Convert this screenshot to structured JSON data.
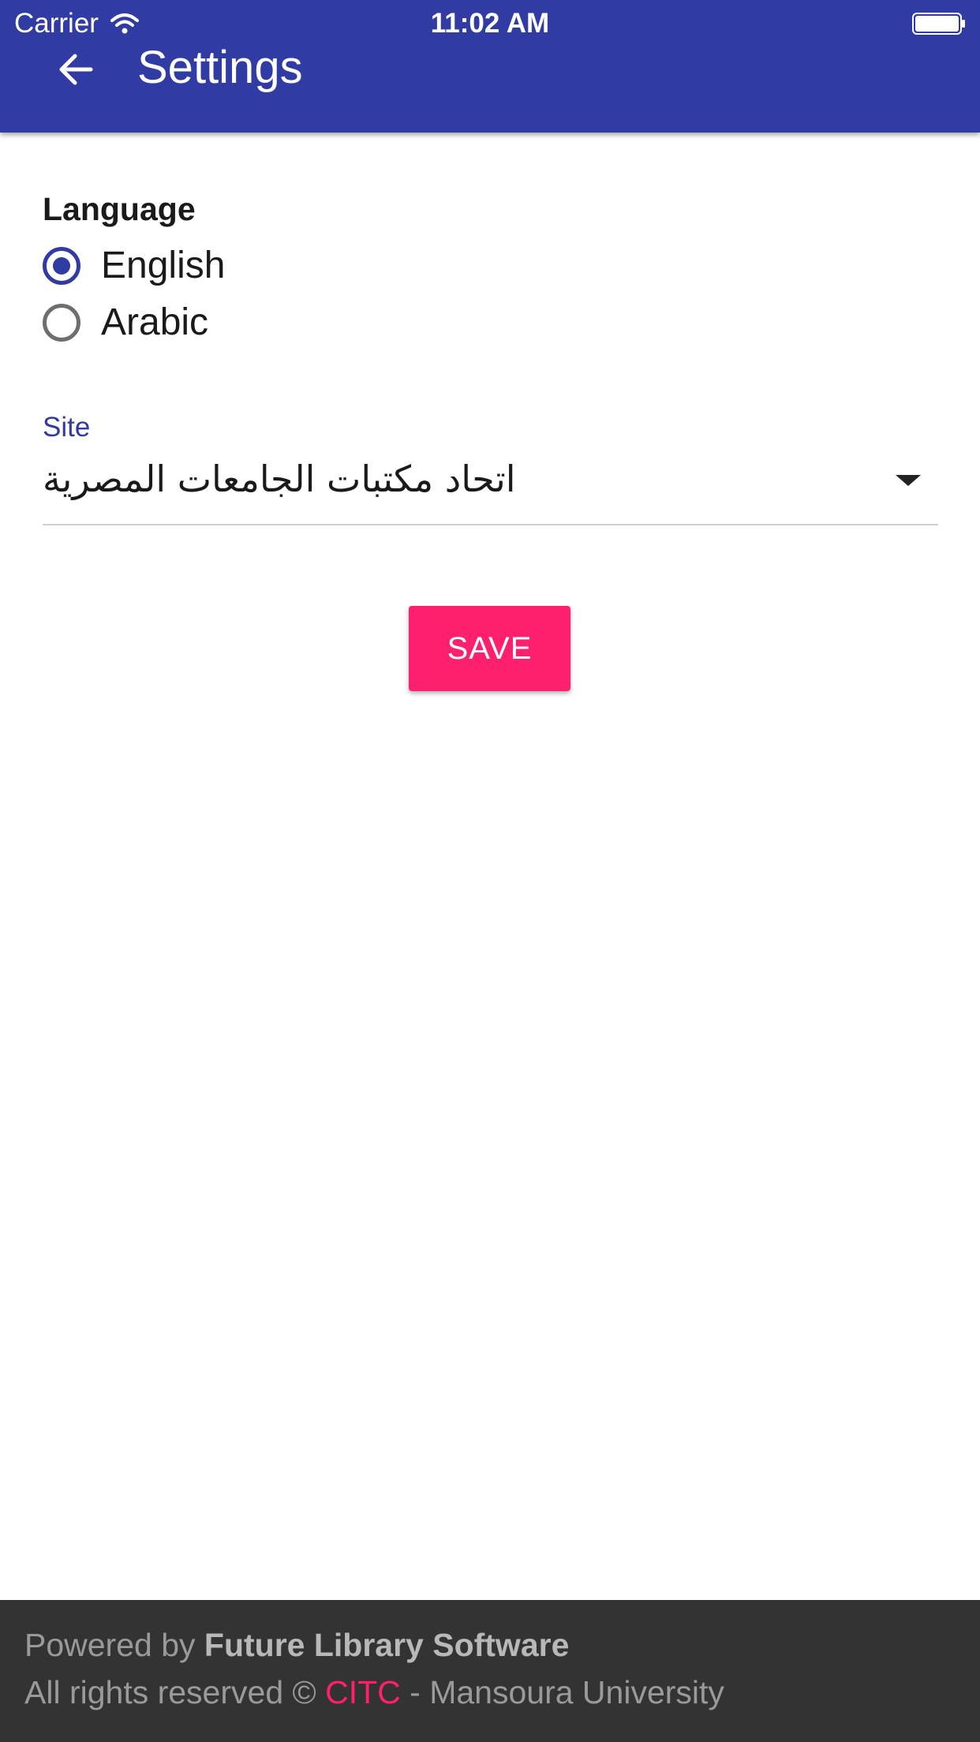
{
  "status_bar": {
    "carrier": "Carrier",
    "time": "11:02 AM"
  },
  "app_bar": {
    "title": "Settings"
  },
  "language": {
    "heading": "Language",
    "options": [
      {
        "label": "English",
        "selected": true
      },
      {
        "label": "Arabic",
        "selected": false
      }
    ]
  },
  "site": {
    "label": "Site",
    "value": "اتحاد مكتبات الجامعات المصرية"
  },
  "save_label": "SAVE",
  "footer": {
    "powered_prefix": "Powered by ",
    "powered_name": "Future Library Software",
    "rights_prefix": "All rights reserved © ",
    "rights_org": "CITC",
    "rights_suffix": " - Mansoura University"
  },
  "colors": {
    "primary": "#303ba4",
    "accent": "#ff1f6f",
    "footer_bg": "#333333"
  },
  "icons": {
    "back": "arrow-left",
    "wifi": "wifi",
    "battery": "battery-full",
    "dropdown": "caret-down"
  }
}
